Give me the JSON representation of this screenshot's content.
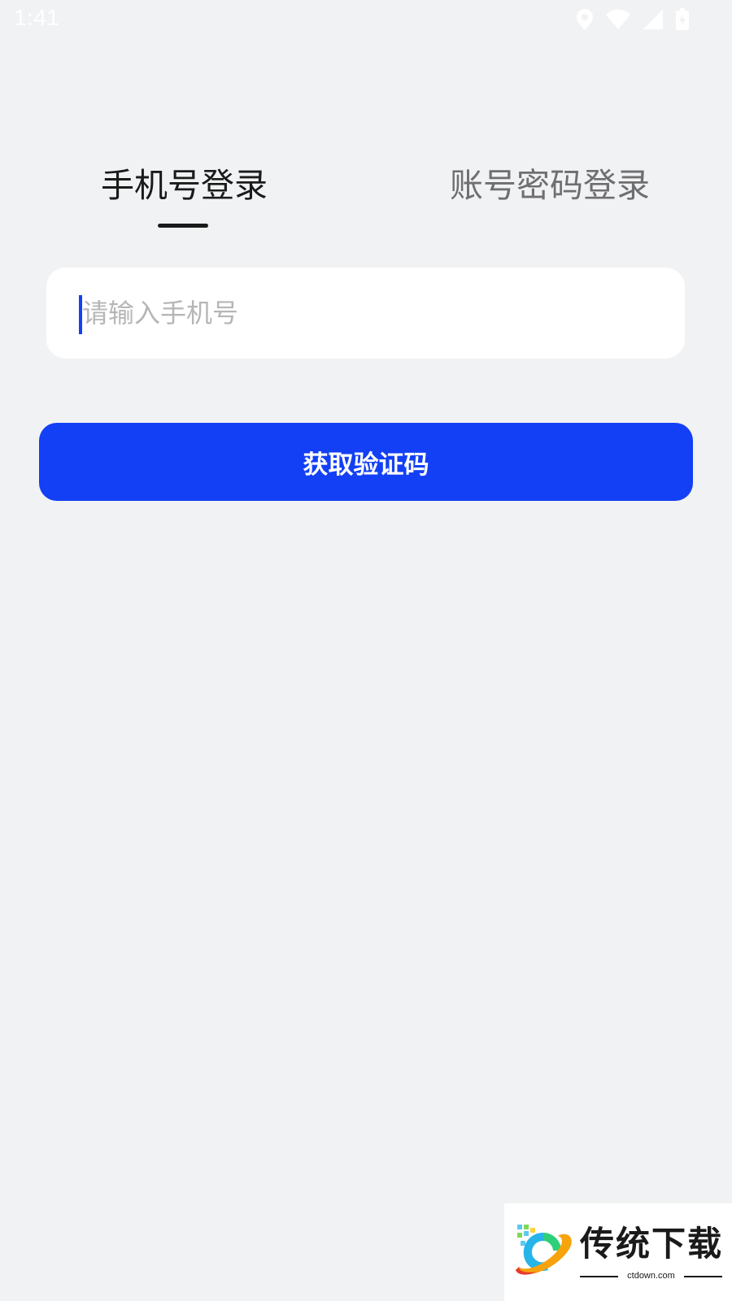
{
  "status_bar": {
    "time": "1:41",
    "icons": [
      "location-icon",
      "wifi-icon",
      "signal-icon",
      "battery-charging-icon"
    ]
  },
  "tabs": [
    {
      "label": "手机号登录",
      "active": true
    },
    {
      "label": "账号密码登录",
      "active": false
    }
  ],
  "phone_field": {
    "placeholder": "请输入手机号",
    "value": ""
  },
  "otp_button": {
    "label": "获取验证码"
  },
  "watermark": {
    "title": "传统下载",
    "domain": "ctdown.com"
  },
  "colors": {
    "background": "#f1f2f4",
    "primary": "#1340f5",
    "active_tab": "#1b1b1b",
    "inactive_tab": "#6f6f6f",
    "placeholder": "#b6b6b6"
  }
}
